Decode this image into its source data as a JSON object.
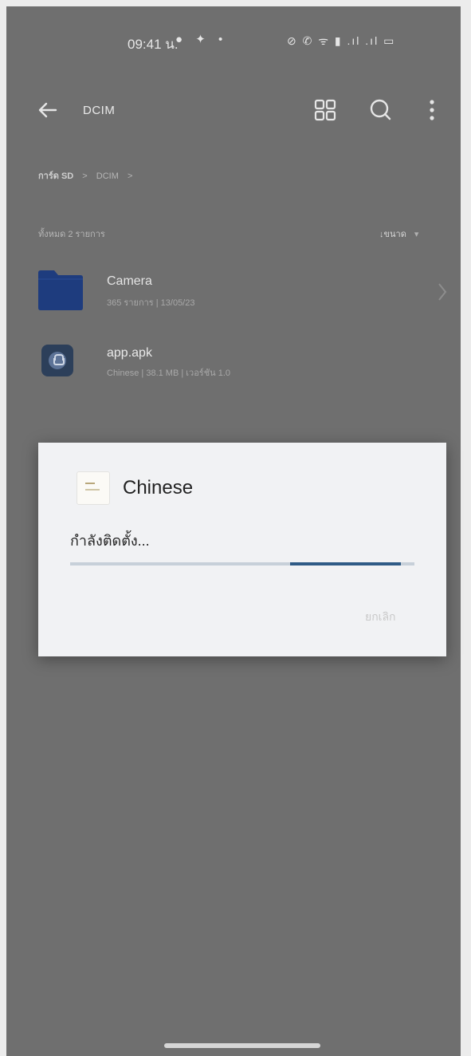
{
  "status_bar": {
    "time": "09:41 น.",
    "left_icons": "● ✦ •",
    "right_icons": "⊘ ✆ ᯤ ▮ .ıl .ıl ▭"
  },
  "app_bar": {
    "title": "DCIM"
  },
  "breadcrumb": {
    "root": "การ์ด SD",
    "separator": ">",
    "current": "DCIM"
  },
  "list_header": {
    "count": "ทั้งหมด 2 รายการ",
    "sort_label": "↓ขนาด",
    "sort_caret": "▾"
  },
  "items": [
    {
      "name": "Camera",
      "meta": "365 รายการ | 13/05/23",
      "icon": "folder-icon"
    },
    {
      "name": "app.apk",
      "meta": "Chinese | 38.1 MB | เวอร์ชัน 1.0",
      "icon": "apk-icon"
    }
  ],
  "install_dialog": {
    "app_name": "Chinese",
    "status": "กำลังติดตั้ง...",
    "progress_start": 0.64,
    "progress_end": 0.96,
    "cancel_label": "ยกเลิก"
  },
  "colors": {
    "scrim": "#6f6f6f",
    "dialog_bg": "#f1f2f4",
    "progress_track": "#c7d0d9",
    "progress_fill": "#2f5b86",
    "folder_blue": "#1e3c7e"
  }
}
